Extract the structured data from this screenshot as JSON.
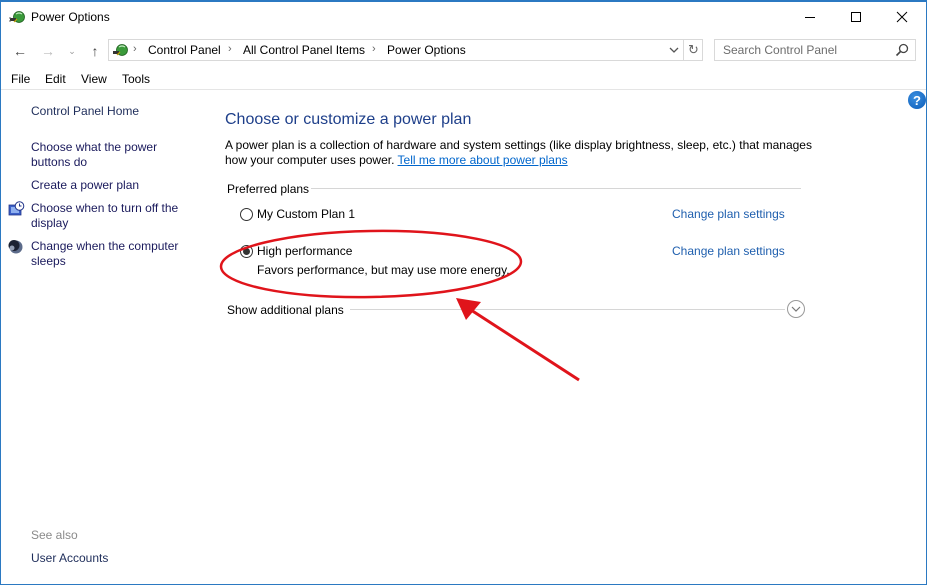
{
  "window": {
    "title": "Power Options",
    "app_icon": "power-options-icon",
    "controls": {
      "minimize": "minimize-icon",
      "maximize": "maximize-icon",
      "close": "close-icon"
    }
  },
  "navigation": {
    "back": "←",
    "forward": "→",
    "recent": "⌄",
    "up": "↑",
    "breadcrumb": [
      {
        "label": "Control Panel"
      },
      {
        "label": "All Control Panel Items"
      },
      {
        "label": "Power Options"
      }
    ],
    "separator": "›",
    "dropdown": "⌄",
    "refresh": "↻",
    "search": {
      "placeholder": "Search Control Panel",
      "value": ""
    }
  },
  "menu": {
    "items": [
      {
        "label": "File"
      },
      {
        "label": "Edit"
      },
      {
        "label": "View"
      },
      {
        "label": "Tools"
      }
    ]
  },
  "help": {
    "label": "?"
  },
  "sidebar": {
    "home": "Control Panel Home",
    "links": [
      {
        "label": "Choose what the power buttons do",
        "icon": null
      },
      {
        "label": "Create a power plan",
        "icon": null
      },
      {
        "label": "Choose when to turn off the display",
        "icon": "display-clock-icon"
      },
      {
        "label": "Change when the computer sleeps",
        "icon": "sleep-moon-icon"
      }
    ],
    "see_also": {
      "heading": "See also",
      "links": [
        {
          "label": "User Accounts"
        }
      ]
    }
  },
  "main": {
    "heading": "Choose or customize a power plan",
    "description": "A power plan is a collection of hardware and system settings (like display brightness, sleep, etc.) that manages how your computer uses power.",
    "learn_more_link": "Tell me more about power plans",
    "preferred_plans_label": "Preferred plans",
    "plans": [
      {
        "name": "My Custom Plan 1",
        "description": "",
        "selected": false,
        "change_link": "Change plan settings"
      },
      {
        "name": "High performance",
        "description": "Favors performance, but may use more energy.",
        "selected": true,
        "change_link": "Change plan settings"
      }
    ],
    "additional_plans_label": "Show additional plans",
    "expand_icon": "chevron-down-circle-icon"
  },
  "annotation": {
    "color": "#e0141b",
    "highlight_target": "High performance",
    "shapes": [
      "ellipse-highlight",
      "arrow"
    ]
  }
}
